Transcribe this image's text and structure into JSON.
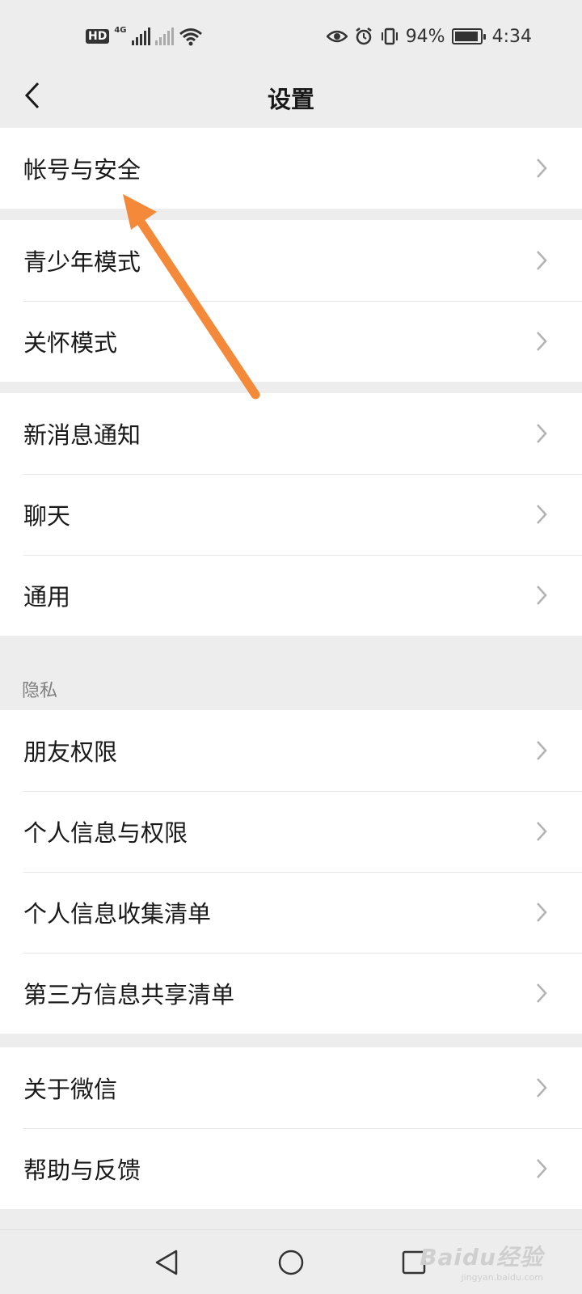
{
  "status_bar": {
    "hd_label": "HD",
    "network_label": "4G",
    "battery_text": "94%",
    "battery_level": 0.94,
    "time": "4:34",
    "icons": [
      "hd-icon",
      "signal-icon",
      "signal-no-sim-icon",
      "wifi-icon",
      "eye-icon",
      "alarm-icon",
      "vibrate-icon",
      "battery-icon"
    ]
  },
  "nav": {
    "title": "设置",
    "back_icon": "chevron-left-icon"
  },
  "groups": [
    {
      "items": [
        {
          "label": "帐号与安全"
        }
      ]
    },
    {
      "items": [
        {
          "label": "青少年模式"
        },
        {
          "label": "关怀模式"
        }
      ]
    },
    {
      "items": [
        {
          "label": "新消息通知"
        },
        {
          "label": "聊天"
        },
        {
          "label": "通用"
        }
      ]
    },
    {
      "header": "隐私",
      "items": [
        {
          "label": "朋友权限"
        },
        {
          "label": "个人信息与权限"
        },
        {
          "label": "个人信息收集清单"
        },
        {
          "label": "第三方信息共享清单"
        }
      ]
    },
    {
      "items": [
        {
          "label": "关于微信"
        },
        {
          "label": "帮助与反馈"
        }
      ]
    }
  ],
  "annotation": {
    "color": "#f5893a",
    "points_to": "帐号与安全"
  },
  "system_nav": {
    "buttons": [
      "back-triangle-icon",
      "home-circle-icon",
      "recents-square-icon"
    ]
  },
  "watermark": {
    "logo": "Baidu经验",
    "url": "jingyan.baidu.com"
  }
}
